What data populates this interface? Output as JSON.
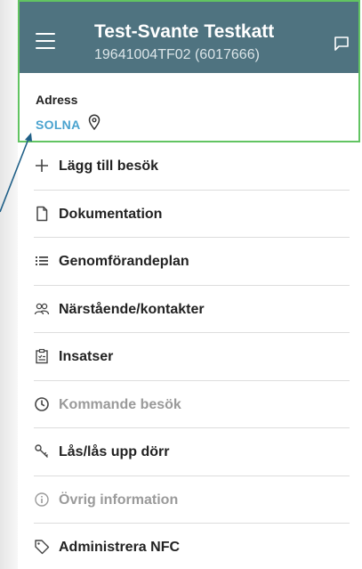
{
  "header": {
    "title": "Test-Svante Testkatt",
    "subtitle": "19641004TF02 (6017666)"
  },
  "address": {
    "label": "Adress",
    "value": "SOLNA"
  },
  "menu": {
    "items": [
      {
        "label": "Lägg till besök",
        "icon": "plus-icon",
        "enabled": true
      },
      {
        "label": "Dokumentation",
        "icon": "document-icon",
        "enabled": true
      },
      {
        "label": "Genomförandeplan",
        "icon": "list-icon",
        "enabled": true
      },
      {
        "label": "Närstående/kontakter",
        "icon": "contacts-icon",
        "enabled": true
      },
      {
        "label": "Insatser",
        "icon": "clipboard-icon",
        "enabled": true
      },
      {
        "label": "Kommande besök",
        "icon": "clock-icon",
        "enabled": false
      },
      {
        "label": "Lås/lås upp dörr",
        "icon": "key-icon",
        "enabled": true
      },
      {
        "label": "Övrig information",
        "icon": "info-icon",
        "enabled": false
      },
      {
        "label": "Administrera NFC",
        "icon": "tag-icon",
        "enabled": true
      }
    ]
  },
  "colors": {
    "topbar": "#4f7380",
    "highlight_border": "#62c462",
    "address_link": "#4aa3cf",
    "annotation_arrow": "#1f5f87"
  }
}
